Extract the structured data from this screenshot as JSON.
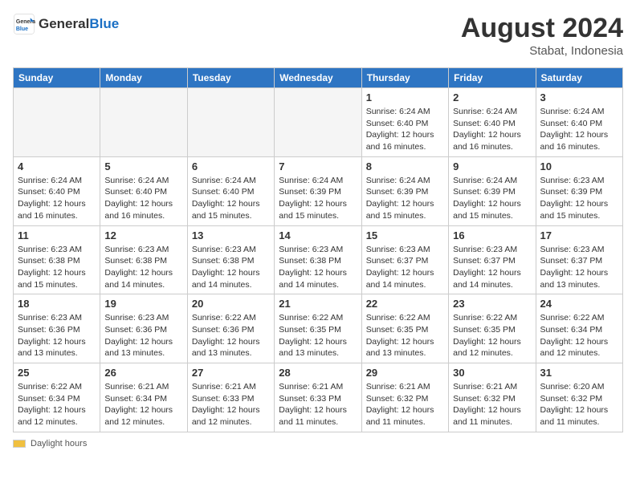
{
  "header": {
    "logo_line1": "General",
    "logo_line2": "Blue",
    "month_year": "August 2024",
    "location": "Stabat, Indonesia"
  },
  "days_of_week": [
    "Sunday",
    "Monday",
    "Tuesday",
    "Wednesday",
    "Thursday",
    "Friday",
    "Saturday"
  ],
  "legend": {
    "label": "Daylight hours"
  },
  "weeks": [
    [
      {
        "day": "",
        "empty": true
      },
      {
        "day": "",
        "empty": true
      },
      {
        "day": "",
        "empty": true
      },
      {
        "day": "",
        "empty": true
      },
      {
        "day": "1",
        "sunrise": "Sunrise: 6:24 AM",
        "sunset": "Sunset: 6:40 PM",
        "daylight": "Daylight: 12 hours and 16 minutes."
      },
      {
        "day": "2",
        "sunrise": "Sunrise: 6:24 AM",
        "sunset": "Sunset: 6:40 PM",
        "daylight": "Daylight: 12 hours and 16 minutes."
      },
      {
        "day": "3",
        "sunrise": "Sunrise: 6:24 AM",
        "sunset": "Sunset: 6:40 PM",
        "daylight": "Daylight: 12 hours and 16 minutes."
      }
    ],
    [
      {
        "day": "4",
        "sunrise": "Sunrise: 6:24 AM",
        "sunset": "Sunset: 6:40 PM",
        "daylight": "Daylight: 12 hours and 16 minutes."
      },
      {
        "day": "5",
        "sunrise": "Sunrise: 6:24 AM",
        "sunset": "Sunset: 6:40 PM",
        "daylight": "Daylight: 12 hours and 16 minutes."
      },
      {
        "day": "6",
        "sunrise": "Sunrise: 6:24 AM",
        "sunset": "Sunset: 6:40 PM",
        "daylight": "Daylight: 12 hours and 15 minutes."
      },
      {
        "day": "7",
        "sunrise": "Sunrise: 6:24 AM",
        "sunset": "Sunset: 6:39 PM",
        "daylight": "Daylight: 12 hours and 15 minutes."
      },
      {
        "day": "8",
        "sunrise": "Sunrise: 6:24 AM",
        "sunset": "Sunset: 6:39 PM",
        "daylight": "Daylight: 12 hours and 15 minutes."
      },
      {
        "day": "9",
        "sunrise": "Sunrise: 6:24 AM",
        "sunset": "Sunset: 6:39 PM",
        "daylight": "Daylight: 12 hours and 15 minutes."
      },
      {
        "day": "10",
        "sunrise": "Sunrise: 6:23 AM",
        "sunset": "Sunset: 6:39 PM",
        "daylight": "Daylight: 12 hours and 15 minutes."
      }
    ],
    [
      {
        "day": "11",
        "sunrise": "Sunrise: 6:23 AM",
        "sunset": "Sunset: 6:38 PM",
        "daylight": "Daylight: 12 hours and 15 minutes."
      },
      {
        "day": "12",
        "sunrise": "Sunrise: 6:23 AM",
        "sunset": "Sunset: 6:38 PM",
        "daylight": "Daylight: 12 hours and 14 minutes."
      },
      {
        "day": "13",
        "sunrise": "Sunrise: 6:23 AM",
        "sunset": "Sunset: 6:38 PM",
        "daylight": "Daylight: 12 hours and 14 minutes."
      },
      {
        "day": "14",
        "sunrise": "Sunrise: 6:23 AM",
        "sunset": "Sunset: 6:38 PM",
        "daylight": "Daylight: 12 hours and 14 minutes."
      },
      {
        "day": "15",
        "sunrise": "Sunrise: 6:23 AM",
        "sunset": "Sunset: 6:37 PM",
        "daylight": "Daylight: 12 hours and 14 minutes."
      },
      {
        "day": "16",
        "sunrise": "Sunrise: 6:23 AM",
        "sunset": "Sunset: 6:37 PM",
        "daylight": "Daylight: 12 hours and 14 minutes."
      },
      {
        "day": "17",
        "sunrise": "Sunrise: 6:23 AM",
        "sunset": "Sunset: 6:37 PM",
        "daylight": "Daylight: 12 hours and 13 minutes."
      }
    ],
    [
      {
        "day": "18",
        "sunrise": "Sunrise: 6:23 AM",
        "sunset": "Sunset: 6:36 PM",
        "daylight": "Daylight: 12 hours and 13 minutes."
      },
      {
        "day": "19",
        "sunrise": "Sunrise: 6:23 AM",
        "sunset": "Sunset: 6:36 PM",
        "daylight": "Daylight: 12 hours and 13 minutes."
      },
      {
        "day": "20",
        "sunrise": "Sunrise: 6:22 AM",
        "sunset": "Sunset: 6:36 PM",
        "daylight": "Daylight: 12 hours and 13 minutes."
      },
      {
        "day": "21",
        "sunrise": "Sunrise: 6:22 AM",
        "sunset": "Sunset: 6:35 PM",
        "daylight": "Daylight: 12 hours and 13 minutes."
      },
      {
        "day": "22",
        "sunrise": "Sunrise: 6:22 AM",
        "sunset": "Sunset: 6:35 PM",
        "daylight": "Daylight: 12 hours and 13 minutes."
      },
      {
        "day": "23",
        "sunrise": "Sunrise: 6:22 AM",
        "sunset": "Sunset: 6:35 PM",
        "daylight": "Daylight: 12 hours and 12 minutes."
      },
      {
        "day": "24",
        "sunrise": "Sunrise: 6:22 AM",
        "sunset": "Sunset: 6:34 PM",
        "daylight": "Daylight: 12 hours and 12 minutes."
      }
    ],
    [
      {
        "day": "25",
        "sunrise": "Sunrise: 6:22 AM",
        "sunset": "Sunset: 6:34 PM",
        "daylight": "Daylight: 12 hours and 12 minutes."
      },
      {
        "day": "26",
        "sunrise": "Sunrise: 6:21 AM",
        "sunset": "Sunset: 6:34 PM",
        "daylight": "Daylight: 12 hours and 12 minutes."
      },
      {
        "day": "27",
        "sunrise": "Sunrise: 6:21 AM",
        "sunset": "Sunset: 6:33 PM",
        "daylight": "Daylight: 12 hours and 12 minutes."
      },
      {
        "day": "28",
        "sunrise": "Sunrise: 6:21 AM",
        "sunset": "Sunset: 6:33 PM",
        "daylight": "Daylight: 12 hours and 11 minutes."
      },
      {
        "day": "29",
        "sunrise": "Sunrise: 6:21 AM",
        "sunset": "Sunset: 6:32 PM",
        "daylight": "Daylight: 12 hours and 11 minutes."
      },
      {
        "day": "30",
        "sunrise": "Sunrise: 6:21 AM",
        "sunset": "Sunset: 6:32 PM",
        "daylight": "Daylight: 12 hours and 11 minutes."
      },
      {
        "day": "31",
        "sunrise": "Sunrise: 6:20 AM",
        "sunset": "Sunset: 6:32 PM",
        "daylight": "Daylight: 12 hours and 11 minutes."
      }
    ]
  ]
}
